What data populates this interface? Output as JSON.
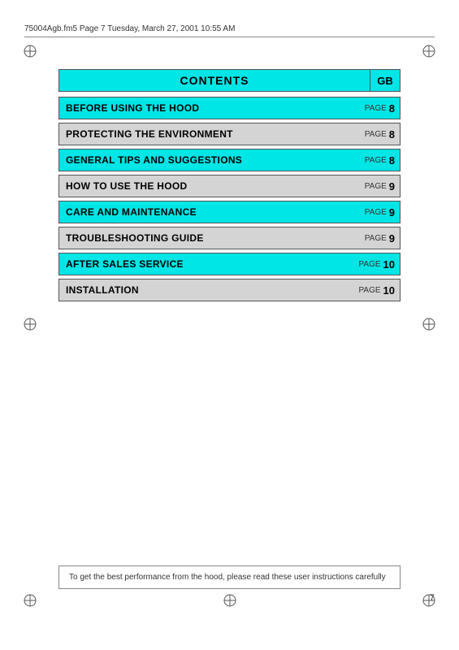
{
  "header": {
    "filename": "75004Agb.fm5  Page 7  Tuesday, March 27, 2001  10:55 AM"
  },
  "contents": {
    "title": "CONTENTS",
    "gb_label": "GB",
    "rows": [
      {
        "label": "BEFORE USING THE HOOD",
        "page_word": "PAGE",
        "page_num": "8",
        "cyan": true
      },
      {
        "label": "PROTECTING THE ENVIRONMENT",
        "page_word": "PAGE",
        "page_num": "8",
        "cyan": false
      },
      {
        "label": "GENERAL TIPS AND SUGGESTIONS",
        "page_word": "PAGE",
        "page_num": "8",
        "cyan": true
      },
      {
        "label": "HOW TO USE THE HOOD",
        "page_word": "PAGE",
        "page_num": "9",
        "cyan": false
      },
      {
        "label": "CARE AND MAINTENANCE",
        "page_word": "PAGE",
        "page_num": "9",
        "cyan": true
      },
      {
        "label": "TROUBLESHOOTING GUIDE",
        "page_word": "PAGE",
        "page_num": "9",
        "cyan": false
      },
      {
        "label": "AFTER SALES SERVICE",
        "page_word": "PAGE",
        "page_num": "10",
        "cyan": true
      },
      {
        "label": "INSTALLATION",
        "page_word": "PAGE",
        "page_num": "10",
        "cyan": false
      }
    ]
  },
  "bottom_note": "To get the best performance from the hood, please read these user instructions carefully",
  "page_number": "7"
}
